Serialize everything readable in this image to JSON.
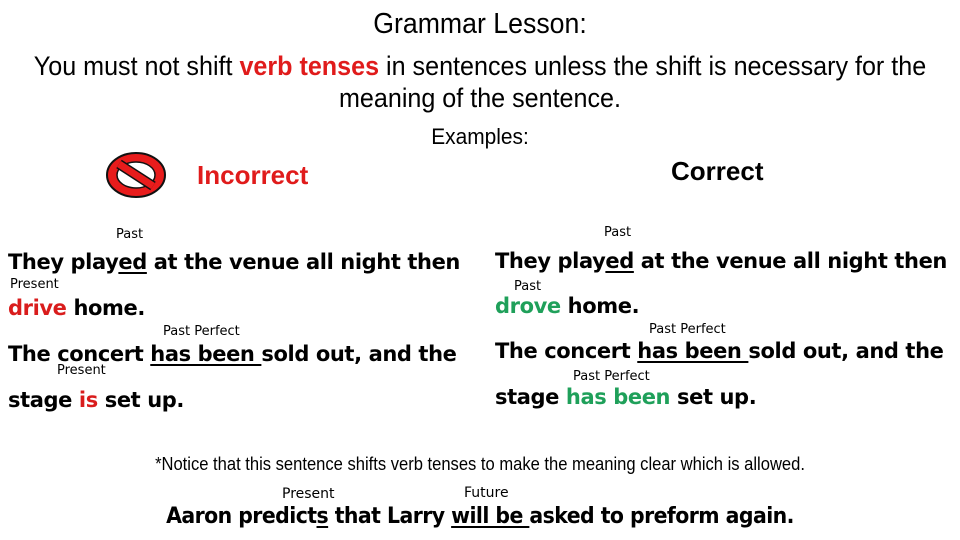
{
  "header": {
    "title": "Grammar Lesson:",
    "rule_before": "You must not shift ",
    "rule_highlight": "verb tenses",
    "rule_after": " in sentences unless the shift is necessary for the meaning of the sentence.",
    "examples_label": "Examples:"
  },
  "incorrect": {
    "icon": "prohibited-icon",
    "heading": "Incorrect",
    "sentence1": {
      "label_top": "Past",
      "line1_a": "They play",
      "line1_underlined": "ed",
      "line1_b": " at the venue all night then",
      "label_mid": "Present",
      "verb": "drive",
      "line2_rest": " home."
    },
    "sentence2": {
      "label_top": "Past Perfect",
      "line1_a": "The concert ",
      "line1_underlined": "has been ",
      "line1_b": "sold out, and the",
      "label_mid": "Present",
      "line2_a": "stage ",
      "verb": "is",
      "line2_rest": " set up."
    }
  },
  "correct": {
    "heading": "Correct",
    "sentence1": {
      "label_top": "Past",
      "line1_a": "They play",
      "line1_underlined": "ed",
      "line1_b": " at the venue all night then",
      "label_mid": "Past",
      "verb": "drove",
      "line2_rest": " home."
    },
    "sentence2": {
      "label_top": "Past Perfect",
      "line1_a": "The concert ",
      "line1_underlined": "has been ",
      "line1_b": "sold out, and the",
      "label_mid": "Past Perfect",
      "line2_a": "stage ",
      "verb": "has been",
      "line2_rest": " set up."
    }
  },
  "notice": {
    "text": "*Notice that this sentence shifts verb tenses to make the meaning clear which is allowed.",
    "label_present": "Present",
    "label_future": "Future",
    "sentence_a": "Aaron predict",
    "sentence_underlined1": "s",
    "sentence_b": " that Larry ",
    "sentence_underlined2": "will be ",
    "sentence_c": "asked to preform again."
  },
  "colors": {
    "incorrect_red": "#e01b1b",
    "wrong_verb_red": "#d91c1c",
    "correct_green": "#1fa05a"
  }
}
